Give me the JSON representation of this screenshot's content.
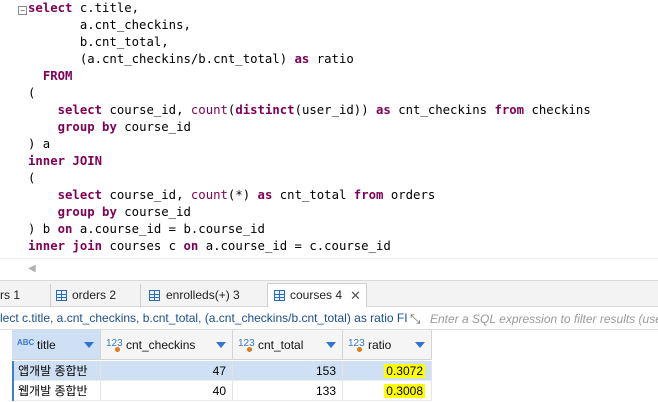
{
  "editor": {
    "fold_marker": "−",
    "lines": [
      [
        {
          "t": "select",
          "c": "kw"
        },
        {
          "t": " c.title,",
          "c": ""
        }
      ],
      [
        {
          "t": "       a.cnt_checkins,",
          "c": ""
        }
      ],
      [
        {
          "t": "       b.cnt_total,",
          "c": ""
        }
      ],
      [
        {
          "t": "       (a.cnt_checkins/b.cnt_total) ",
          "c": ""
        },
        {
          "t": "as",
          "c": "kw"
        },
        {
          "t": " ratio",
          "c": ""
        }
      ],
      [
        {
          "t": "  ",
          "c": ""
        },
        {
          "t": "FROM",
          "c": "kw"
        }
      ],
      [
        {
          "t": "(",
          "c": ""
        }
      ],
      [
        {
          "t": "    ",
          "c": ""
        },
        {
          "t": "select",
          "c": "kw"
        },
        {
          "t": " course_id, ",
          "c": ""
        },
        {
          "t": "count",
          "c": "fn"
        },
        {
          "t": "(",
          "c": ""
        },
        {
          "t": "distinct",
          "c": "kw"
        },
        {
          "t": "(user_id)) ",
          "c": ""
        },
        {
          "t": "as",
          "c": "kw"
        },
        {
          "t": " cnt_checkins ",
          "c": ""
        },
        {
          "t": "from",
          "c": "kw"
        },
        {
          "t": " checkins",
          "c": ""
        }
      ],
      [
        {
          "t": "    ",
          "c": ""
        },
        {
          "t": "group by",
          "c": "kw"
        },
        {
          "t": " course_id",
          "c": ""
        }
      ],
      [
        {
          "t": ") a",
          "c": ""
        }
      ],
      [
        {
          "t": "inner JOIN",
          "c": "kw"
        }
      ],
      [
        {
          "t": "(",
          "c": ""
        }
      ],
      [
        {
          "t": "    ",
          "c": ""
        },
        {
          "t": "select",
          "c": "kw"
        },
        {
          "t": " course_id, ",
          "c": ""
        },
        {
          "t": "count",
          "c": "fn"
        },
        {
          "t": "(*) ",
          "c": ""
        },
        {
          "t": "as",
          "c": "kw"
        },
        {
          "t": " cnt_total ",
          "c": ""
        },
        {
          "t": "from",
          "c": "kw"
        },
        {
          "t": " orders",
          "c": ""
        }
      ],
      [
        {
          "t": "    ",
          "c": ""
        },
        {
          "t": "group by",
          "c": "kw"
        },
        {
          "t": " course_id",
          "c": ""
        }
      ],
      [
        {
          "t": ") b ",
          "c": ""
        },
        {
          "t": "on",
          "c": "kw"
        },
        {
          "t": " a.course_id = b.course_id",
          "c": ""
        }
      ],
      [
        {
          "t": "inner join",
          "c": "kw"
        },
        {
          "t": " courses c ",
          "c": ""
        },
        {
          "t": "on",
          "c": "kw"
        },
        {
          "t": " a.course_id = c.course_id",
          "c": ""
        }
      ]
    ]
  },
  "tabs": {
    "t0": "rs 1",
    "t1": "orders 2",
    "t2": "enrolleds(+) 3",
    "t3": "courses 4",
    "close": "✕"
  },
  "filter": {
    "sql_text": "lect c.title, a.cnt_checkins, b.cnt_total, (a.cnt_checkins/b.cnt_total) as ratio FI",
    "placeholder": "Enter a SQL expression to filter results (use"
  },
  "grid": {
    "headers": {
      "title": "title",
      "cnt_checkins": "cnt_checkins",
      "cnt_total": "cnt_total",
      "ratio": "ratio"
    },
    "type_text": "ABC",
    "type_num": "123",
    "rows": [
      {
        "title": "앱개발 종합반",
        "cnt_checkins": "47",
        "cnt_total": "153",
        "ratio": "0.3072"
      },
      {
        "title": "웹개발 종합반",
        "cnt_checkins": "40",
        "cnt_total": "133",
        "ratio": "0.3008"
      }
    ]
  },
  "colors": {
    "keyword": "#7f0055",
    "selection": "#cfe0f5",
    "highlight": "#ffff00"
  }
}
